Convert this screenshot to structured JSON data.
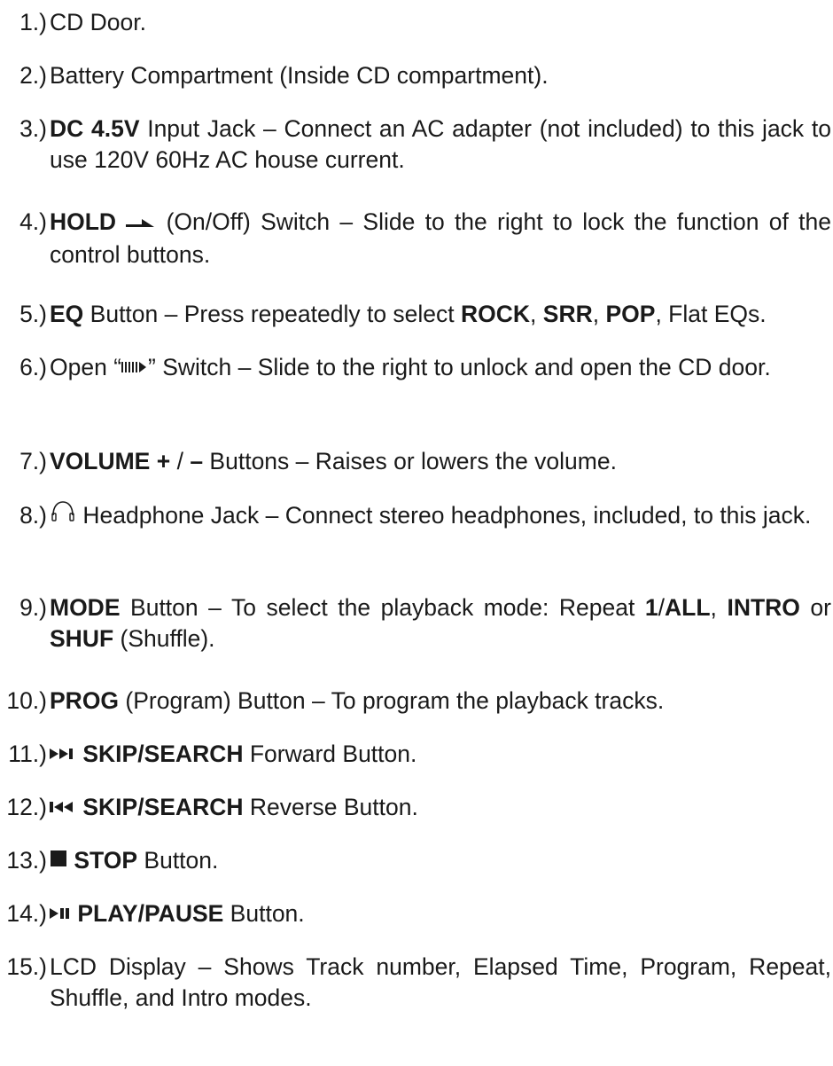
{
  "items": [
    {
      "num": "1.)",
      "segments": [
        {
          "t": "CD Door."
        }
      ]
    },
    {
      "num": "2.)",
      "segments": [
        {
          "t": "Battery Compartment (Inside CD compartment)."
        }
      ]
    },
    {
      "num": "3.)",
      "segments": [
        {
          "t": "DC 4.5V",
          "b": true
        },
        {
          "t": " Input Jack – Connect an AC adapter (not included) to this jack to use 120V 60Hz AC house current."
        }
      ]
    },
    {
      "num": "4.)",
      "segments": [
        {
          "t": "HOLD",
          "b": true
        },
        {
          "t": " "
        },
        {
          "icon": "hold-arrow-icon"
        },
        {
          "t": " (On/Off) Switch – Slide to the right to lock the function of the control buttons."
        }
      ]
    },
    {
      "num": "5.)",
      "segments": [
        {
          "t": "EQ",
          "b": true
        },
        {
          "t": " Button – Press repeatedly to select "
        },
        {
          "t": "ROCK",
          "b": true
        },
        {
          "t": ", "
        },
        {
          "t": "SRR",
          "b": true
        },
        {
          "t": ", "
        },
        {
          "t": "POP",
          "b": true
        },
        {
          "t": ", Flat EQs."
        }
      ]
    },
    {
      "num": "6.)",
      "segments": [
        {
          "t": "Open “"
        },
        {
          "icon": "open-door-icon"
        },
        {
          "t": "” Switch – Slide to the right to unlock and open the CD door."
        }
      ]
    },
    {
      "num": "7.)",
      "segments": [
        {
          "t": "VOLUME + ",
          "b": true
        },
        {
          "t": "/ "
        },
        {
          "t": "–",
          "b": true
        },
        {
          "t": " Buttons – Raises or lowers the volume."
        }
      ]
    },
    {
      "num": "8.)",
      "segments": [
        {
          "icon": "headphone-icon"
        },
        {
          "t": " Headphone Jack – Connect stereo headphones, included, to this jack."
        }
      ]
    },
    {
      "num": "9.)",
      "segments": [
        {
          "t": "MODE",
          "b": true
        },
        {
          "t": " Button – To select the playback mode: Repeat "
        },
        {
          "t": "1",
          "b": true
        },
        {
          "t": "/"
        },
        {
          "t": "ALL",
          "b": true
        },
        {
          "t": ", "
        },
        {
          "t": "INTRO",
          "b": true
        },
        {
          "t": " or "
        },
        {
          "t": "SHUF",
          "b": true
        },
        {
          "t": " (Shuffle)."
        }
      ]
    },
    {
      "num": "10.)",
      "segments": [
        {
          "t": "PROG",
          "b": true
        },
        {
          "t": " (Program) Button – To program the playback tracks."
        }
      ]
    },
    {
      "num": "11.)",
      "segments": [
        {
          "icon": "skip-forward-icon"
        },
        {
          "t": " SKIP/SEARCH",
          "b": true
        },
        {
          "t": " Forward Button."
        }
      ]
    },
    {
      "num": "12.)",
      "segments": [
        {
          "icon": "skip-reverse-icon"
        },
        {
          "t": " SKIP/SEARCH",
          "b": true
        },
        {
          "t": " Reverse Button."
        }
      ]
    },
    {
      "num": "13.)",
      "segments": [
        {
          "icon": "stop-icon"
        },
        {
          "t": " STOP",
          "b": true
        },
        {
          "t": " Button."
        }
      ]
    },
    {
      "num": "14.)",
      "segments": [
        {
          "icon": "play-pause-icon"
        },
        {
          "t": " PLAY/PAUSE",
          "b": true
        },
        {
          "t": " Button."
        }
      ]
    },
    {
      "num": "15.)",
      "segments": [
        {
          "t": "LCD Display – Shows Track number, Elapsed Time, Program, Repeat, Shuffle, and Intro modes."
        }
      ]
    }
  ]
}
